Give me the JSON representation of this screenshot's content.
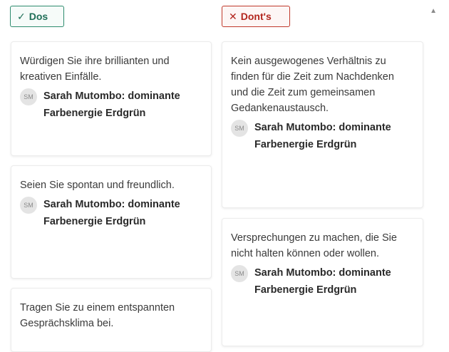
{
  "headers": {
    "dos": {
      "icon": "check-icon",
      "glyph": "✓",
      "label": "Dos",
      "color": "#2e8b6e"
    },
    "donts": {
      "icon": "close-icon",
      "glyph": "✕",
      "label": "Dont's",
      "color": "#c0392b"
    }
  },
  "scrollbar": {
    "up_glyph": "▲"
  },
  "dos_cards": [
    {
      "text": "Würdigen Sie ihre brillianten und kreativen Einfälle.",
      "author": {
        "initials": "SM",
        "name": "Sarah Mutombo: dominante Farbenergie Erdgrün"
      }
    },
    {
      "text": "Seien Sie spontan und freundlich.",
      "author": {
        "initials": "SM",
        "name": "Sarah Mutombo: dominante Farbenergie Erdgrün"
      }
    },
    {
      "text": "Tragen Sie zu einem entspannten Gesprächsklima bei."
    }
  ],
  "donts_cards": [
    {
      "text": "Kein ausgewogenes Verhältnis zu finden für die Zeit zum Nachdenken und die Zeit zum gemeinsamen Gedankenaustausch.",
      "author": {
        "initials": "SM",
        "name": "Sarah Mutombo: dominante Farbenergie Erdgrün"
      }
    },
    {
      "text": "Versprechungen zu machen, die Sie nicht halten können oder wollen.",
      "author": {
        "initials": "SM",
        "name": "Sarah Mutombo: dominante Farbenergie Erdgrün"
      }
    }
  ]
}
